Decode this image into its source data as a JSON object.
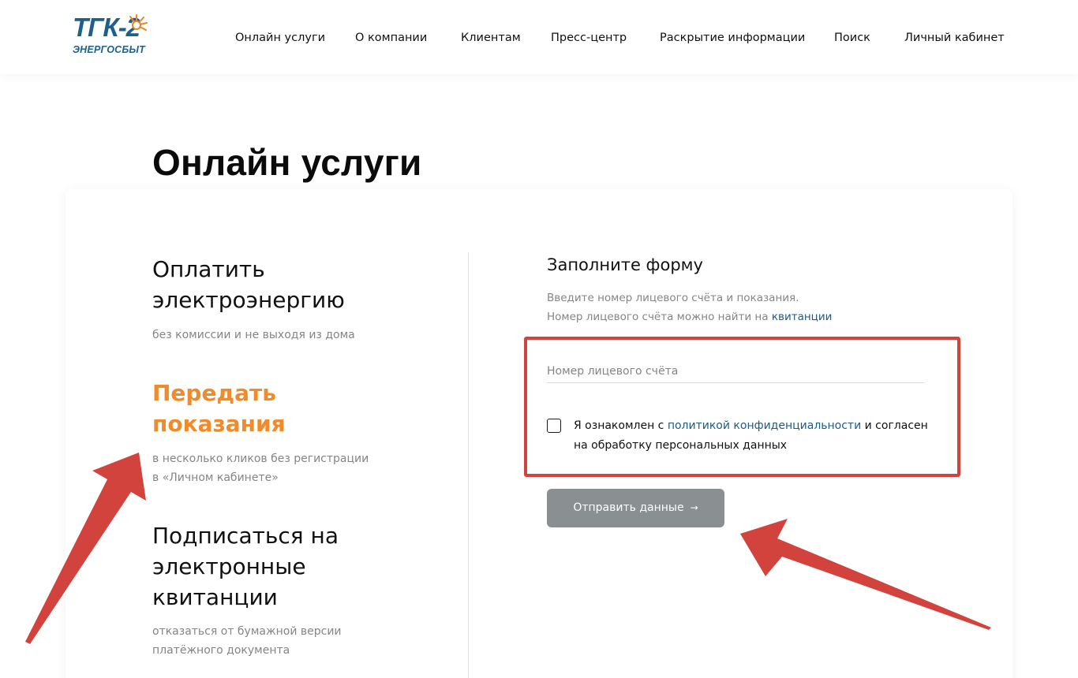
{
  "header": {
    "logo": {
      "main": "ТГК-2",
      "sub": "ЭНЕРГОСБЫТ"
    },
    "nav": [
      {
        "label": "Онлайн услуги"
      },
      {
        "label": "О компании"
      },
      {
        "label": "Клиентам"
      },
      {
        "label": "Пресс-центр"
      },
      {
        "label": "Раскрытие информации"
      },
      {
        "label": "Поиск"
      },
      {
        "label": "Личный кабинет"
      }
    ]
  },
  "page": {
    "title": "Онлайн услуги"
  },
  "services": [
    {
      "title_line1": "Оплатить",
      "title_line2": "электроэнергию",
      "sub_line1": "без комиссии и не выходя из дома",
      "active": false
    },
    {
      "title_line1": "Передать",
      "title_line2": "показания",
      "sub_line1": "в несколько кликов без регистрации",
      "sub_line2": "в «Личном кабинете»",
      "active": true
    },
    {
      "title_line1": "Подписаться на",
      "title_line2": "электронные",
      "title_line3": "квитанции",
      "sub_line1": "отказаться от бумажной версии",
      "sub_line2": "платёжного документа",
      "active": false
    }
  ],
  "form": {
    "title": "Заполните форму",
    "desc_line1": "Введите номер лицевого счёта и показания.",
    "desc_line2_prefix": "Номер лицевого счёта можно найти на ",
    "desc_line2_link": "квитанции",
    "account_input": {
      "value": "",
      "placeholder": "Номер лицевого счёта"
    },
    "consent": {
      "prefix": "Я ознакомлен с ",
      "link": "политикой конфиденциальности",
      "suffix": " и согласен на обработку персональных данных",
      "checked": false
    },
    "submit_label": "Отправить данные",
    "submit_arrow": "→"
  },
  "colors": {
    "accent_orange": "#f08b2c",
    "link_blue": "#1e5b86",
    "logo_blue": "#1f5f8c",
    "annotation_red": "#d1433c",
    "button_gray": "#8a8f92",
    "muted_text": "#858585"
  }
}
